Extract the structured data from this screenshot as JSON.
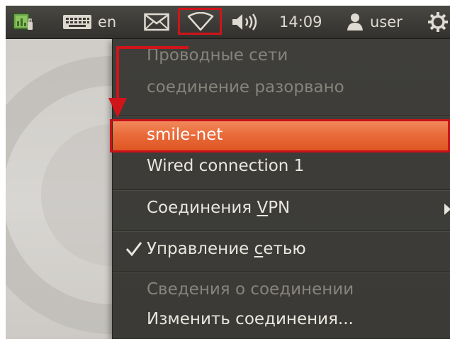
{
  "panel": {
    "language": "en",
    "clock": "14:09",
    "user": "user",
    "icons": [
      "system-monitor-icon",
      "keyboard-icon",
      "mail-icon",
      "network-wireless-icon",
      "volume-icon",
      "user-icon",
      "gear-icon"
    ]
  },
  "menu": {
    "wired_header": "Проводные сети",
    "wired_status": "соединение разорвано",
    "connections": [
      {
        "label": "smile-net",
        "highlighted": true
      },
      {
        "label": "Wired connection 1",
        "highlighted": false
      }
    ],
    "vpn_prefix": "Соединения ",
    "vpn_mnemonic": "V",
    "vpn_suffix": "PN",
    "manage_prefix": "Управление ",
    "manage_mnemonic": "с",
    "manage_suffix": "етью",
    "manage_checked": true,
    "info": "Сведения о соединении",
    "edit": "Изменить соединения..."
  },
  "colors": {
    "panel": "#3c3b37",
    "menu": "#3c3b37",
    "highlight": "#e96a3a",
    "annotation": "#d0141a"
  }
}
